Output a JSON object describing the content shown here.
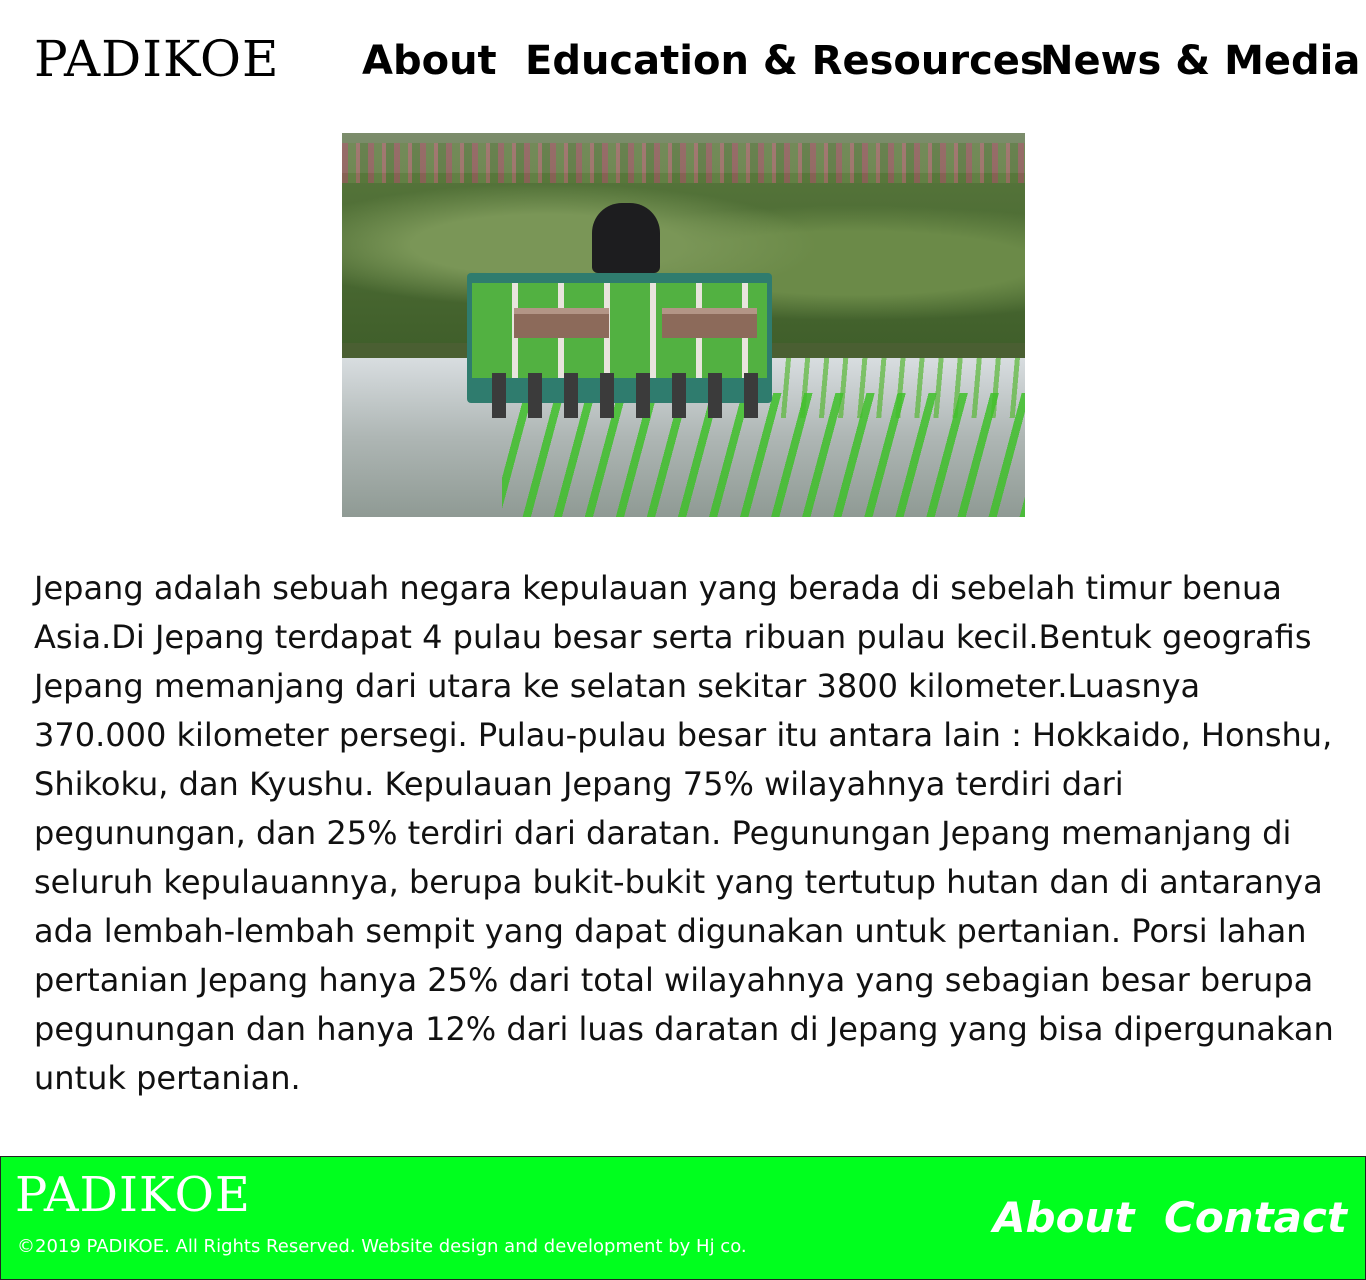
{
  "header": {
    "logo": "PADIKOE",
    "nav": {
      "about": "About",
      "education": "Education & Resources",
      "news": "News & Media"
    }
  },
  "hero": {
    "alt": "Rice transplanter machine planting seedlings in a flooded paddy field"
  },
  "article": {
    "text": "Jepang adalah sebuah negara kepulauan yang berada di sebelah timur benua Asia.Di Jepang terdapat 4 pulau besar serta ribuan pulau kecil.Bentuk geografis Jepang memanjang dari utara ke selatan sekitar 3800 kilometer.Luasnya 370.000 kilometer persegi. Pulau-pulau besar itu antara lain : Hokkaido, Honshu, Shikoku, dan Kyushu. Kepulauan Jepang 75% wilayahnya terdiri dari pegunungan, dan 25% terdiri dari daratan. Pegunungan Jepang memanjang di seluruh kepulauannya, berupa bukit-bukit yang tertutup hutan dan di antaranya ada lembah-lembah sempit yang dapat digunakan untuk pertanian. Porsi lahan pertanian Jepang hanya 25% dari total wilayahnya yang sebagian besar berupa pegunungan dan hanya 12% dari luas daratan di Jepang yang bisa dipergunakan untuk pertanian."
  },
  "footer": {
    "logo": "PADIKOE",
    "copyright": "©2019 PADIKOE. All Rights Reserved. Website design and development by Hj co.",
    "links": {
      "about": "About",
      "contact": "Contact"
    }
  },
  "colors": {
    "footer_bg": "#00ff1e",
    "footer_text": "#ffffff",
    "text": "#111111"
  }
}
